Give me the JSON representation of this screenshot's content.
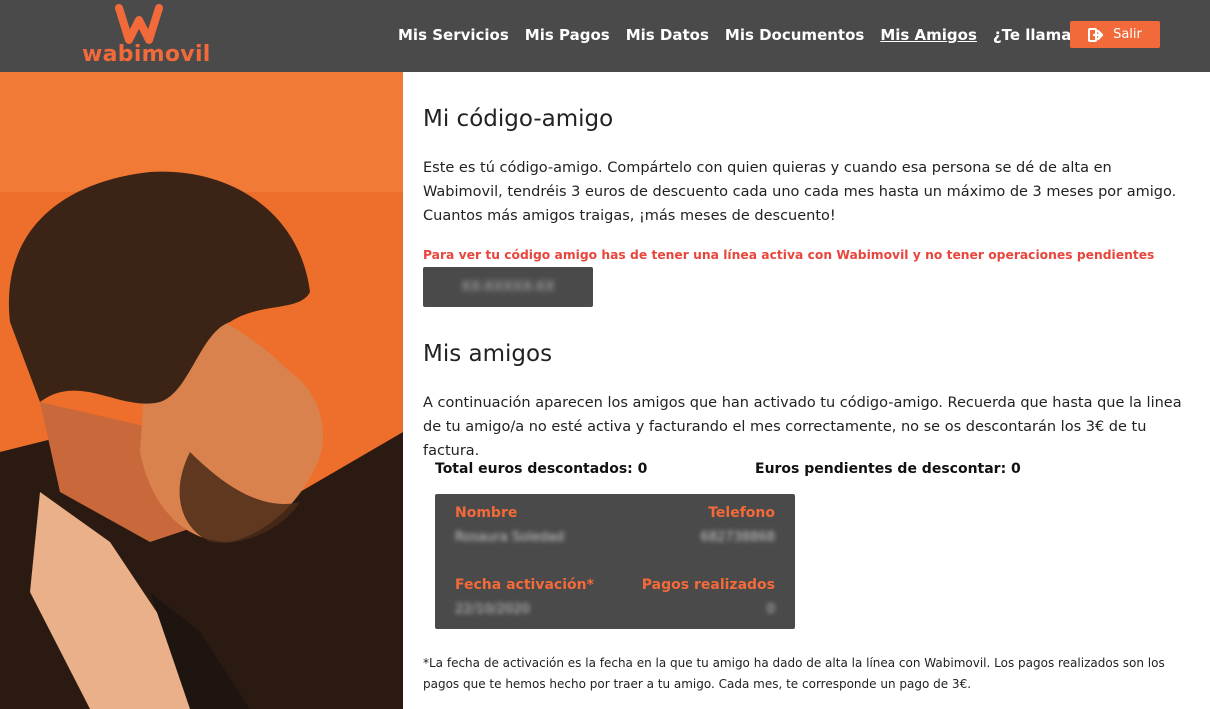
{
  "brand": {
    "logo_text": "wabimovil",
    "accent": "#f26a3a",
    "header_bg": "#4a4a4a"
  },
  "nav": {
    "items": [
      {
        "label": "Mis Servicios"
      },
      {
        "label": "Mis Pagos"
      },
      {
        "label": "Mis Datos"
      },
      {
        "label": "Mis Documentos"
      },
      {
        "label": "Mis Amigos",
        "active": true
      },
      {
        "label": "¿Te llamamos?"
      }
    ],
    "logout_label": "Salir",
    "logout_icon": "sign-out-icon"
  },
  "codigo": {
    "title": "Mi código-amigo",
    "description": "Este es tú código-amigo. Compártelo con quien quieras y cuando esa persona se dé de alta en Wabimovil, tendréis 3 euros de descuento cada uno cada mes hasta un máximo de 3 meses por amigo. Cuantos más amigos traigas, ¡más meses de descuento!",
    "warning": "Para ver tu código amigo has de tener una línea activa con Wabimovil y no tener operaciones pendientes",
    "code_value": "XX-XXXXX-XX"
  },
  "amigos": {
    "title": "Mis amigos",
    "description": "A continuación aparecen los amigos que han activado tu código-amigo. Recuerda que hasta que la linea de tu amigo/a no esté activa y facturando el mes correctamente, no se os descontarán los 3€ de tu factura.",
    "total_label": "Total euros descontados: 0",
    "pending_label": "Euros pendientes de descontar: 0",
    "card": {
      "name_label": "Nombre",
      "phone_label": "Telefono",
      "date_label": "Fecha activación*",
      "payments_label": "Pagos realizados",
      "name_value": "Rosaura Soledad",
      "phone_value": "682738868",
      "date_value": "22/10/2020",
      "payments_value": "0"
    },
    "footnote": "*La fecha de activación es la fecha en la que tu amigo ha dado de alta la línea con Wabimovil. Los pagos realizados son los pagos que te hemos hecho por traer a tu amigo. Cada mes, te corresponde un pago de 3€."
  }
}
